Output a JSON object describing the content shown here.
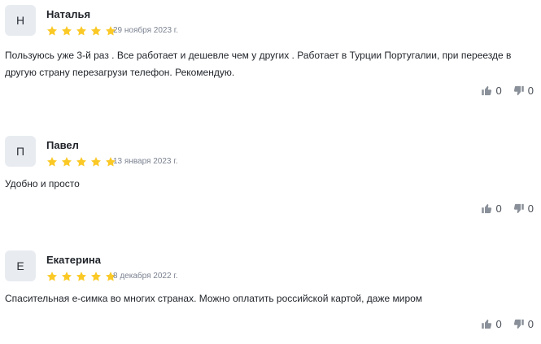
{
  "reviews": [
    {
      "initial": "Н",
      "name": "Наталья",
      "rating": 5,
      "date": "29 ноября 2023 г.",
      "text": "Пользуюсь уже 3-й раз . Все работает и дешевле чем у других . Работает в Турции Португалии, при переезде в другую страну перезагрузи телефон. Рекомендую.",
      "likes": "0",
      "dislikes": "0"
    },
    {
      "initial": "П",
      "name": "Павел",
      "rating": 5,
      "date": "13 января 2023 г.",
      "text": "Удобно и просто",
      "likes": "0",
      "dislikes": "0"
    },
    {
      "initial": "Е",
      "name": "Екатерина",
      "rating": 5,
      "date": "8 декабря 2022 г.",
      "text": "Спасительная е-симка во многих странах. Можно оплатить российской картой, даже миром",
      "likes": "0",
      "dislikes": "0"
    }
  ],
  "colors": {
    "star": "#fbc926",
    "avatar_bg": "#e8ecf1",
    "vote_icon": "#8a9099"
  },
  "icons": {
    "star": "star-icon",
    "like": "thumb-up-icon",
    "dislike": "thumb-down-icon"
  }
}
